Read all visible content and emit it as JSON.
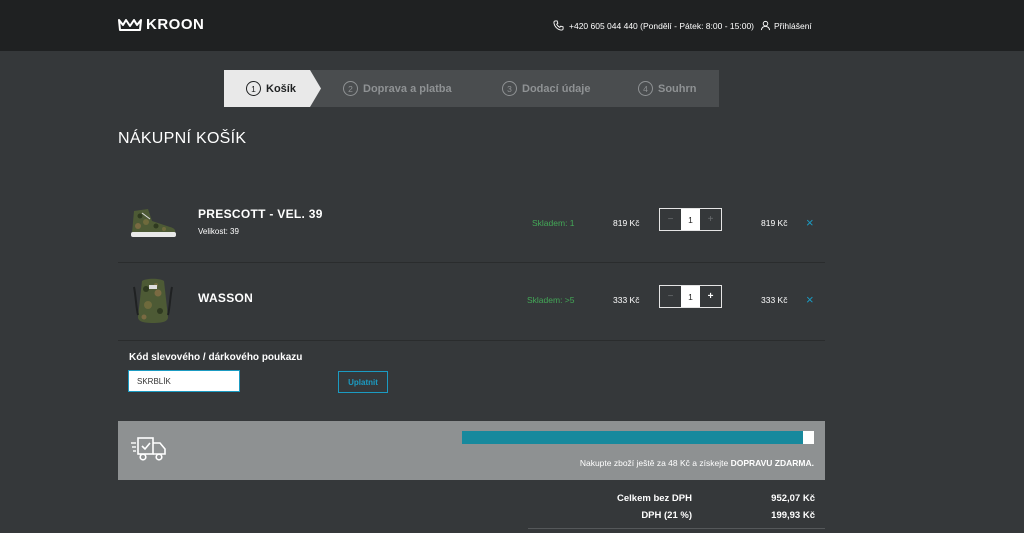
{
  "header": {
    "logo_text": "KROON",
    "phone": "+420 605 044 440 (Pondělí - Pátek: 8:00 - 15:00)",
    "login_label": "Přihlášení"
  },
  "steps": [
    {
      "num": "1",
      "label": "Košík",
      "active": true
    },
    {
      "num": "2",
      "label": "Doprava a platba",
      "active": false
    },
    {
      "num": "3",
      "label": "Dodací údaje",
      "active": false
    },
    {
      "num": "4",
      "label": "Souhrn",
      "active": false
    }
  ],
  "page_title": "NÁKUPNÍ KOŠÍK",
  "cart": {
    "items": [
      {
        "name": "PRESCOTT - VEL. 39",
        "size_label": "Velikost: 39",
        "stock": "Skladem: 1",
        "unit_price": "819 Kč",
        "qty": "1",
        "total": "819 Kč",
        "thumbnail": "camo-sneaker-image"
      },
      {
        "name": "WASSON",
        "size_label": "",
        "stock": "Skladem: >5",
        "unit_price": "333 Kč",
        "qty": "1",
        "total": "333 Kč",
        "thumbnail": "camo-backpack-image"
      }
    ],
    "qty_minus": "−",
    "qty_plus": "+",
    "remove_icon": "×"
  },
  "coupon": {
    "label": "Kód slevového / dárkového poukazu",
    "value": "SKRBLÍK",
    "apply_label": "Uplatnit"
  },
  "shipping": {
    "progress_percent": 97,
    "message_prefix": "Nakupte zboží ještě za 48 Kč a získejte",
    "message_bold": "DOPRAVU ZDARMA."
  },
  "summary": {
    "without_vat_label": "Celkem bez DPH",
    "without_vat_value": "952,07 Kč",
    "vat_label": "DPH (21 %)",
    "vat_value": "199,93 Kč"
  },
  "colors": {
    "accent": "#1b9bc2",
    "stock_green": "#43a857",
    "progress_fill": "#17899d"
  }
}
